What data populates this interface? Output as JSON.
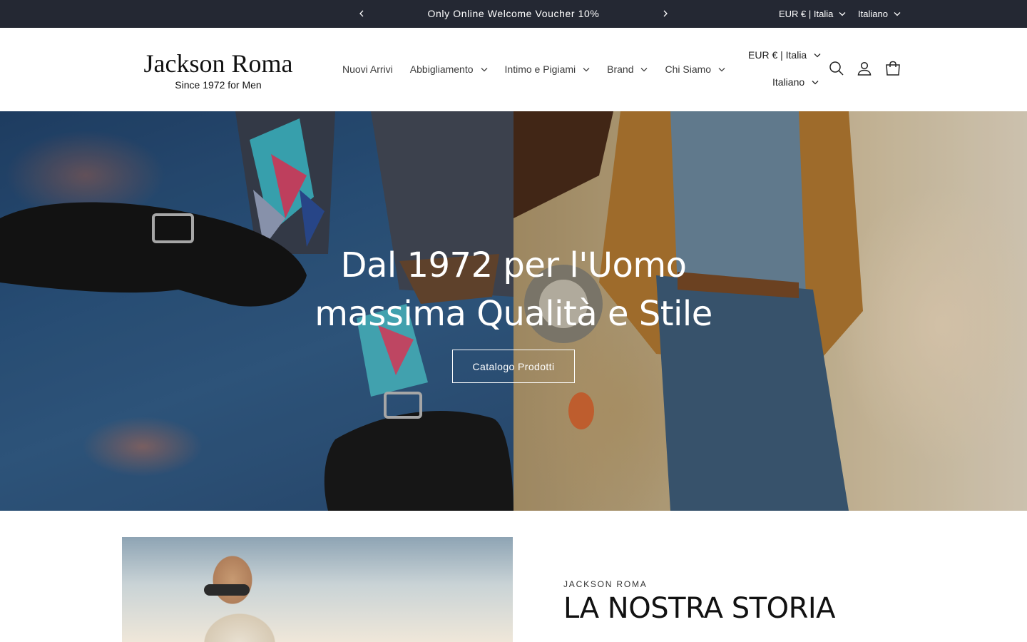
{
  "announcement": {
    "text": "Only Online Welcome Voucher 10%",
    "currency": "EUR € | Italia",
    "language": "Italiano"
  },
  "header": {
    "logo_main": "Jackson Roma",
    "logo_sub": "Since 1972 for Men",
    "nav": [
      {
        "label": "Nuovi Arrivi"
      },
      {
        "label": "Abbigliamento"
      },
      {
        "label": "Intimo e Pigiami"
      },
      {
        "label": "Brand"
      },
      {
        "label": "Chi Siamo"
      }
    ],
    "currency": "EUR € | Italia",
    "language": "Italiano",
    "icons": [
      "search-icon",
      "account-icon",
      "cart-icon"
    ]
  },
  "hero": {
    "heading_line1": "Dal 1972 per l'Uomo",
    "heading_line2": "massima Qualità e Stile",
    "button_label": "Catalogo Prodotti"
  },
  "story": {
    "kicker": "JACKSON ROMA",
    "title": "LA NOSTRA STORIA"
  },
  "colors": {
    "topbar_bg": "#242833",
    "text": "#222222",
    "white": "#ffffff"
  }
}
